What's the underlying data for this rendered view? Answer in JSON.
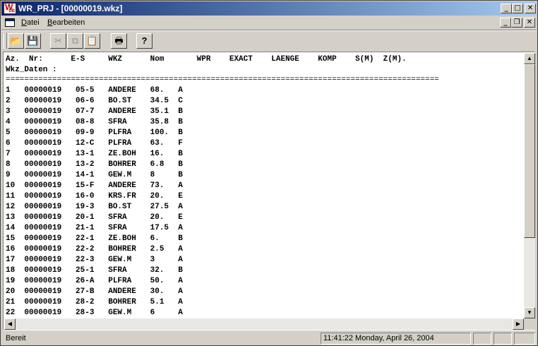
{
  "window": {
    "title": "WR_PRJ - [00000019.wkz]",
    "app_icon_text": "W",
    "app_icon_sub": "DB",
    "buttons": {
      "minimize": "_",
      "maximize": "□",
      "close": "✕"
    }
  },
  "menubar": {
    "items": [
      {
        "label": "Datei",
        "mnemonic": "D",
        "rest": "atei"
      },
      {
        "label": "Bearbeiten",
        "mnemonic": "B",
        "rest": "earbeiten"
      }
    ],
    "mdi_buttons": {
      "minimize": "_",
      "restore": "❐",
      "close": "✕"
    }
  },
  "toolbar": {
    "buttons": [
      {
        "name": "open-button",
        "icon": "folder-open-icon",
        "glyph": "📂",
        "enabled": true
      },
      {
        "name": "save-button",
        "icon": "floppy-icon",
        "glyph": "💾",
        "enabled": true
      },
      {
        "name": "cut-button",
        "icon": "scissors-icon",
        "glyph": "✂",
        "enabled": false
      },
      {
        "name": "copy-button",
        "icon": "copy-icon",
        "glyph": "⧉",
        "enabled": false
      },
      {
        "name": "paste-button",
        "icon": "clipboard-icon",
        "glyph": "📋",
        "enabled": false
      },
      {
        "name": "print-button",
        "icon": "printer-icon",
        "glyph": "🖶",
        "enabled": true
      },
      {
        "name": "help-button",
        "icon": "help-icon",
        "glyph": "?",
        "enabled": true
      }
    ]
  },
  "document": {
    "header_line": "Az.  Nr:      E-S     WKZ      Nom       WPR    EXACT    LAENGE    KOMP    S(M)  Z(M).",
    "subheader_line": "Wkz_Daten :",
    "separator": "=============================================================================================",
    "rows": [
      "1   00000019   05-5   ANDERE   68.   A",
      "2   00000019   06-6   BO.ST    34.5  C",
      "3   00000019   07-7   ANDERE   35.1  B",
      "4   00000019   08-8   SFRA     35.8  B",
      "5   00000019   09-9   PLFRA    100.  B",
      "6   00000019   12-C   PLFRA    63.   F",
      "7   00000019   13-1   ZE.BOH   16.   B",
      "8   00000019   13-2   BOHRER   6.8   B",
      "9   00000019   14-1   GEW.M    8     B",
      "10  00000019   15-F   ANDERE   73.   A",
      "11  00000019   16-0   KRS.FR   20.   E",
      "12  00000019   19-3   BO.ST    27.5  A",
      "13  00000019   20-1   SFRA     20.   E",
      "14  00000019   21-1   SFRA     17.5  A",
      "15  00000019   22-1   ZE.BOH   6.    B",
      "16  00000019   22-2   BOHRER   2.5   A",
      "17  00000019   22-3   GEW.M    3     A",
      "18  00000019   25-1   SFRA     32.   B",
      "19  00000019   26-A   PLFRA    50.   A",
      "20  00000019   27-B   ANDERE   30.   A",
      "21  00000019   28-2   BOHRER   5.1   A",
      "22  00000019   28-3   GEW.M    6     A"
    ]
  },
  "scrollbars": {
    "up": "▲",
    "down": "▼",
    "left": "◀",
    "right": "▶"
  },
  "statusbar": {
    "state": "Bereit",
    "datetime": "11:41:22 Monday, April 26, 2004"
  }
}
